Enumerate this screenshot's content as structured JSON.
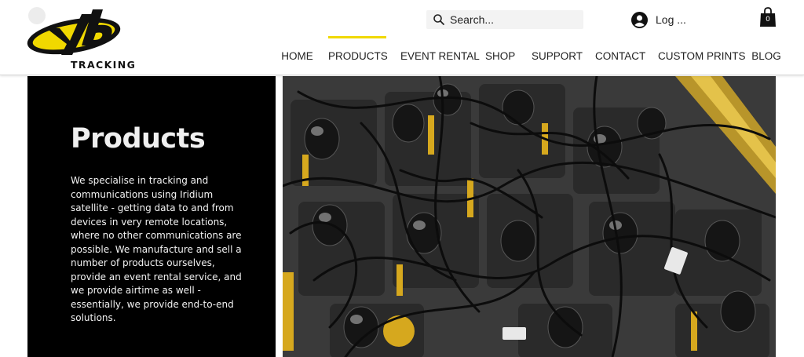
{
  "brand": {
    "logo_text": "TRACKING",
    "yellow": "#f0d800",
    "black": "#111111"
  },
  "header": {
    "search": {
      "placeholder": "Search..."
    },
    "login_label": "Log ...",
    "cart_count": "0"
  },
  "nav": {
    "items": [
      {
        "label": "HOME",
        "active": false
      },
      {
        "label": "PRODUCTS",
        "active": true
      },
      {
        "label": "EVENT RENTAL",
        "active": false
      },
      {
        "label": "SHOP",
        "active": false
      },
      {
        "label": "SUPPORT",
        "active": false
      },
      {
        "label": "CONTACT",
        "active": false
      },
      {
        "label": "CUSTOM PRINTS",
        "active": false
      },
      {
        "label": "BLOG",
        "active": false
      }
    ]
  },
  "hero": {
    "title": "Products",
    "intro": "We specialise in tracking and communications using Iridium satellite - getting data to and from devices in very remote locations, where no other communications are possible. We manufacture and sell a number of products ourselves, provide an event rental service, and we provide airtime as well - essentially, we provide end-to-end solutions."
  },
  "icons": {
    "search": "search-icon",
    "account": "user-avatar-icon",
    "cart": "shopping-bag-icon"
  }
}
